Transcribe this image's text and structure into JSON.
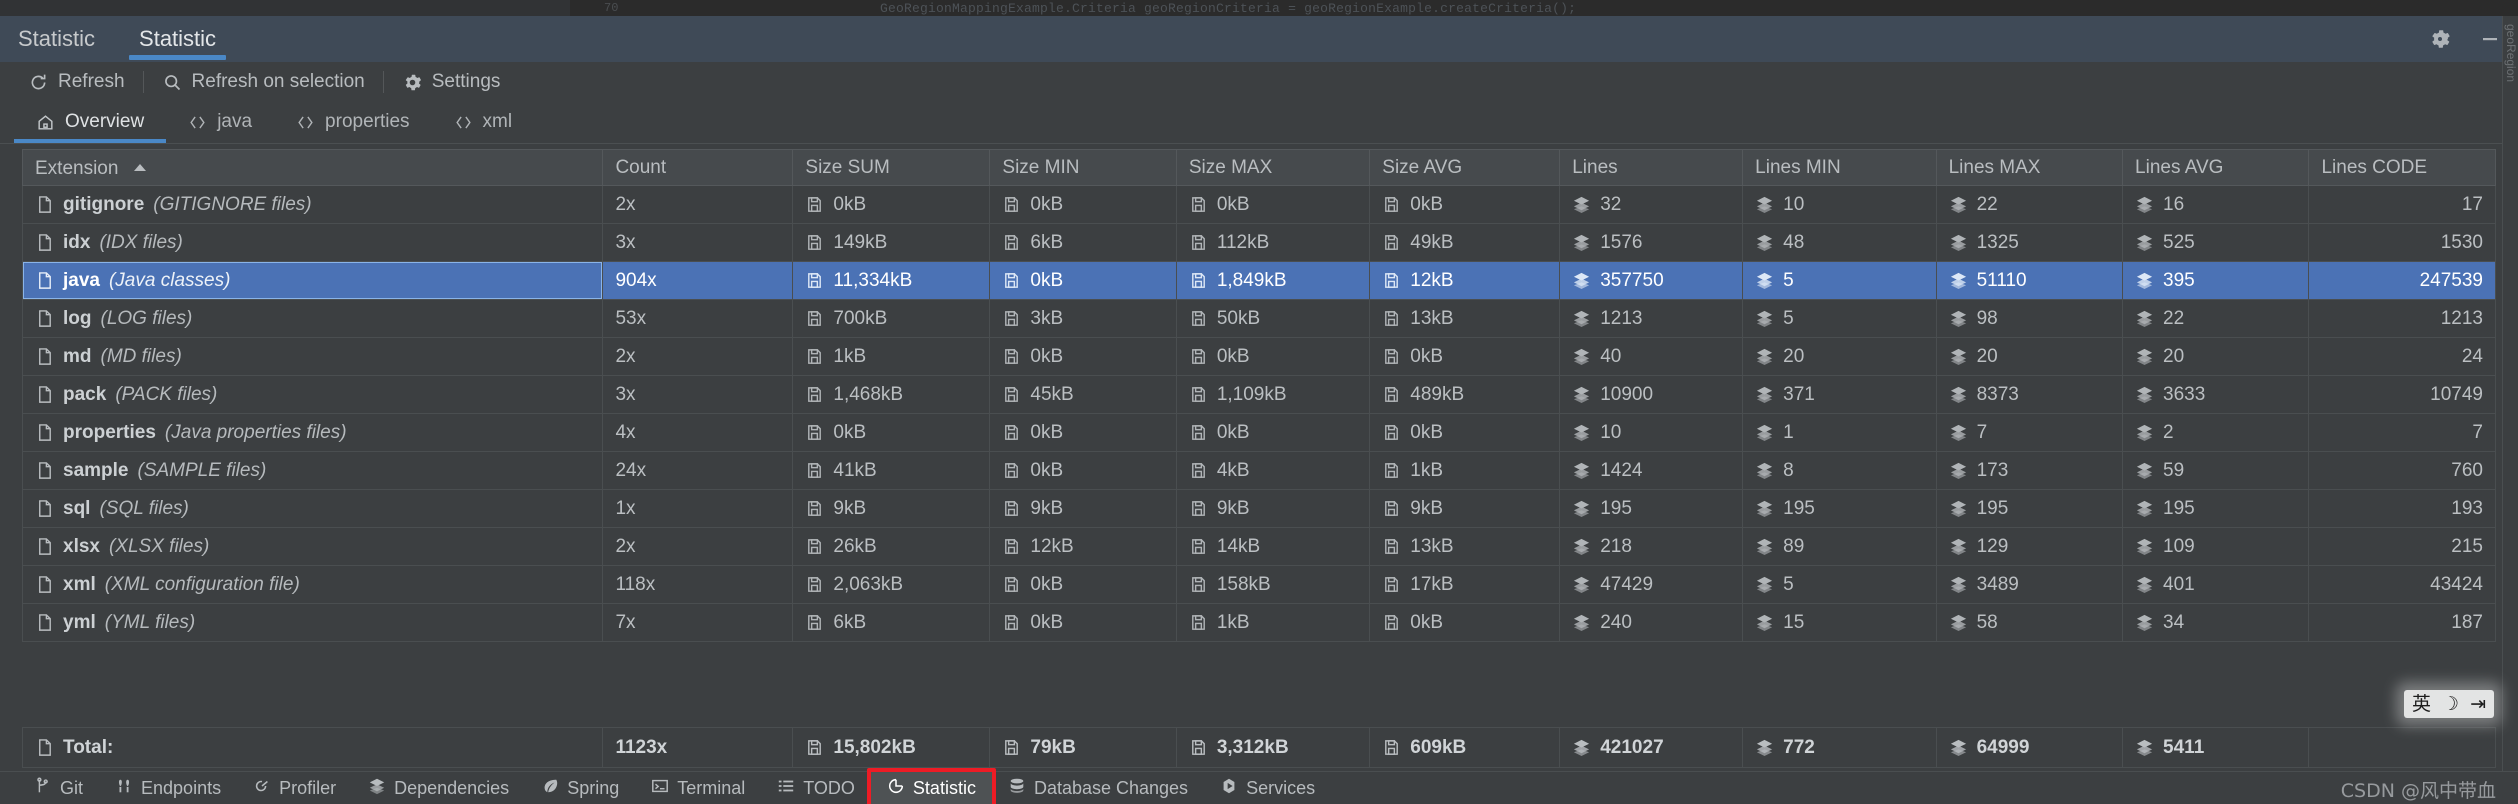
{
  "editor_sliver": {
    "line_number": "70",
    "code_fragment": "GeoRegionMappingExample.Criteria geoRegionCriteria = geoRegionExample.createCriteria();"
  },
  "tool_window": {
    "label": "Statistic",
    "tab": "Statistic",
    "settings_icon": "gear-icon",
    "minimize_icon": "minimize-icon"
  },
  "toolbar": {
    "refresh": "Refresh",
    "refresh_on_selection": "Refresh on selection",
    "settings": "Settings",
    "refresh_icon": "refresh-icon",
    "search_icon": "search-icon",
    "gear_icon": "gear-icon"
  },
  "category_tabs": [
    {
      "label": "Overview",
      "icon": "home-icon",
      "active": true
    },
    {
      "label": "java",
      "icon": "code-brackets-icon",
      "active": false
    },
    {
      "label": "properties",
      "icon": "code-brackets-icon",
      "active": false
    },
    {
      "label": "xml",
      "icon": "code-brackets-icon",
      "active": false
    }
  ],
  "table": {
    "sort_column": "Extension",
    "sort_direction": "ascending",
    "columns": [
      "Extension",
      "Count",
      "Size SUM",
      "Size MIN",
      "Size MAX",
      "Size AVG",
      "Lines",
      "Lines MIN",
      "Lines MAX",
      "Lines AVG",
      "Lines CODE"
    ],
    "rows": [
      {
        "ext": "gitignore",
        "desc": "(GITIGNORE files)",
        "count": "2x",
        "size_sum": "0kB",
        "size_min": "0kB",
        "size_max": "0kB",
        "size_avg": "0kB",
        "lines": "32",
        "lines_min": "10",
        "lines_max": "22",
        "lines_avg": "16",
        "lines_code": "17",
        "selected": false
      },
      {
        "ext": "idx",
        "desc": "(IDX files)",
        "count": "3x",
        "size_sum": "149kB",
        "size_min": "6kB",
        "size_max": "112kB",
        "size_avg": "49kB",
        "lines": "1576",
        "lines_min": "48",
        "lines_max": "1325",
        "lines_avg": "525",
        "lines_code": "1530",
        "selected": false
      },
      {
        "ext": "java",
        "desc": "(Java classes)",
        "count": "904x",
        "size_sum": "11,334kB",
        "size_min": "0kB",
        "size_max": "1,849kB",
        "size_avg": "12kB",
        "lines": "357750",
        "lines_min": "5",
        "lines_max": "51110",
        "lines_avg": "395",
        "lines_code": "247539",
        "selected": true
      },
      {
        "ext": "log",
        "desc": "(LOG files)",
        "count": "53x",
        "size_sum": "700kB",
        "size_min": "3kB",
        "size_max": "50kB",
        "size_avg": "13kB",
        "lines": "1213",
        "lines_min": "5",
        "lines_max": "98",
        "lines_avg": "22",
        "lines_code": "1213",
        "selected": false
      },
      {
        "ext": "md",
        "desc": "(MD files)",
        "count": "2x",
        "size_sum": "1kB",
        "size_min": "0kB",
        "size_max": "0kB",
        "size_avg": "0kB",
        "lines": "40",
        "lines_min": "20",
        "lines_max": "20",
        "lines_avg": "20",
        "lines_code": "24",
        "selected": false
      },
      {
        "ext": "pack",
        "desc": "(PACK files)",
        "count": "3x",
        "size_sum": "1,468kB",
        "size_min": "45kB",
        "size_max": "1,109kB",
        "size_avg": "489kB",
        "lines": "10900",
        "lines_min": "371",
        "lines_max": "8373",
        "lines_avg": "3633",
        "lines_code": "10749",
        "selected": false
      },
      {
        "ext": "properties",
        "desc": "(Java properties files)",
        "count": "4x",
        "size_sum": "0kB",
        "size_min": "0kB",
        "size_max": "0kB",
        "size_avg": "0kB",
        "lines": "10",
        "lines_min": "1",
        "lines_max": "7",
        "lines_avg": "2",
        "lines_code": "7",
        "selected": false
      },
      {
        "ext": "sample",
        "desc": "(SAMPLE files)",
        "count": "24x",
        "size_sum": "41kB",
        "size_min": "0kB",
        "size_max": "4kB",
        "size_avg": "1kB",
        "lines": "1424",
        "lines_min": "8",
        "lines_max": "173",
        "lines_avg": "59",
        "lines_code": "760",
        "selected": false
      },
      {
        "ext": "sql",
        "desc": "(SQL files)",
        "count": "1x",
        "size_sum": "9kB",
        "size_min": "9kB",
        "size_max": "9kB",
        "size_avg": "9kB",
        "lines": "195",
        "lines_min": "195",
        "lines_max": "195",
        "lines_avg": "195",
        "lines_code": "193",
        "selected": false
      },
      {
        "ext": "xlsx",
        "desc": "(XLSX files)",
        "count": "2x",
        "size_sum": "26kB",
        "size_min": "12kB",
        "size_max": "14kB",
        "size_avg": "13kB",
        "lines": "218",
        "lines_min": "89",
        "lines_max": "129",
        "lines_avg": "109",
        "lines_code": "215",
        "selected": false
      },
      {
        "ext": "xml",
        "desc": "(XML configuration file)",
        "count": "118x",
        "size_sum": "2,063kB",
        "size_min": "0kB",
        "size_max": "158kB",
        "size_avg": "17kB",
        "lines": "47429",
        "lines_min": "5",
        "lines_max": "3489",
        "lines_avg": "401",
        "lines_code": "43424",
        "selected": false
      },
      {
        "ext": "yml",
        "desc": "(YML files)",
        "count": "7x",
        "size_sum": "6kB",
        "size_min": "0kB",
        "size_max": "1kB",
        "size_avg": "0kB",
        "lines": "240",
        "lines_min": "15",
        "lines_max": "58",
        "lines_avg": "34",
        "lines_code": "187",
        "selected": false
      }
    ],
    "total": {
      "label": "Total:",
      "count": "1123x",
      "size_sum": "15,802kB",
      "size_min": "79kB",
      "size_max": "3,312kB",
      "size_avg": "609kB",
      "lines": "421027",
      "lines_min": "772",
      "lines_max": "64999",
      "lines_avg": "5411",
      "lines_code": ""
    }
  },
  "status_bar": {
    "items": [
      {
        "label": "Git",
        "icon": "git-branch-icon",
        "active": false
      },
      {
        "label": "Endpoints",
        "icon": "endpoints-icon",
        "active": false
      },
      {
        "label": "Profiler",
        "icon": "profiler-icon",
        "active": false
      },
      {
        "label": "Dependencies",
        "icon": "dependencies-icon",
        "active": false
      },
      {
        "label": "Spring",
        "icon": "spring-leaf-icon",
        "active": false
      },
      {
        "label": "Terminal",
        "icon": "terminal-icon",
        "active": false
      },
      {
        "label": "TODO",
        "icon": "todo-list-icon",
        "active": false
      },
      {
        "label": "Statistic",
        "icon": "pie-chart-icon",
        "active": true
      },
      {
        "label": "Database Changes",
        "icon": "database-icon",
        "active": false
      },
      {
        "label": "Services",
        "icon": "services-play-icon",
        "active": false
      }
    ],
    "highlight_color": "#ee1c25"
  },
  "overlays": {
    "ime": [
      "英",
      "☽",
      "⇥"
    ],
    "watermark": "CSDN @风中带血",
    "rail_text": "geoRegion"
  },
  "colors": {
    "accent": "#4a88c7",
    "selection": "#4b72b5",
    "titlebar": "#3f4a57",
    "background": "#3c3f41",
    "highlight": "#ee1c25"
  }
}
